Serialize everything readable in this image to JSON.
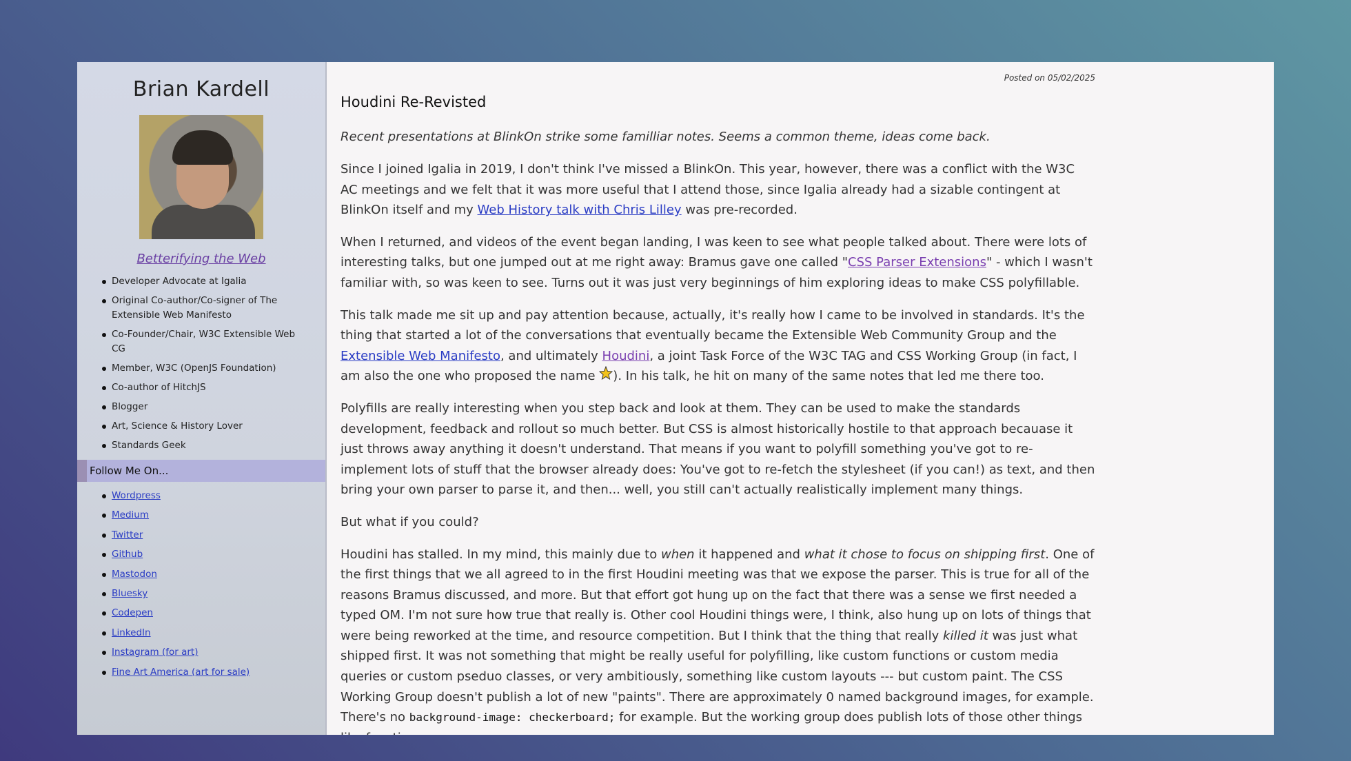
{
  "sidebar": {
    "author_name": "Brian Kardell",
    "blog_link": "Betterifying the Web",
    "bio": [
      "Developer Advocate at Igalia",
      "Original Co-author/Co-signer of The Extensible Web Manifesto",
      "Co-Founder/Chair, W3C Extensible Web CG",
      "Member, W3C (OpenJS Foundation)",
      "Co-author of HitchJS",
      "Blogger",
      "Art, Science & History Lover",
      "Standards Geek"
    ],
    "follow_header": "Follow Me On...",
    "follow_links": [
      "Wordpress",
      "Medium",
      "Twitter",
      "Github",
      "Mastodon",
      "Bluesky",
      "Codepen",
      "LinkedIn",
      "Instagram (for art)",
      "Fine Art America (art for sale)"
    ]
  },
  "article": {
    "posted": "Posted on 05/02/2025",
    "title": "Houdini Re-Revisted",
    "lede": "Recent presentations at BlinkOn strike some familliar notes. Seems a common theme, ideas come back.",
    "p1": {
      "a": "Since I joined Igalia in 2019, I don't think I've missed a BlinkOn. This year, however, there was a conflict with the W3C AC meetings and we felt that it was more useful that I attend those, since Igalia already had a sizable contingent at BlinkOn itself and my ",
      "link": "Web History talk with Chris Lilley",
      "b": " was pre-recorded."
    },
    "p2": {
      "a": "When I returned, and videos of the event began landing, I was keen to see what people talked about. There were lots of interesting talks, but one jumped out at me right away: Bramus gave one called \"",
      "link": "CSS Parser Extensions",
      "b": "\" - which I wasn't familiar with, so was keen to see. Turns out it was just very beginnings of him exploring ideas to make CSS polyfillable."
    },
    "p3": {
      "a": "This talk made me sit up and pay attention because, actually, it's really how I came to be involved in standards. It's the thing that started a lot of the conversations that eventually became the Extensible Web Community Group and the ",
      "link1": "Extensible Web Manifesto",
      "b": ", and ultimately ",
      "link2": "Houdini",
      "c": ", a joint Task Force of the W3C TAG and CSS Working Group (in fact, I am also the one who proposed the name ",
      "d": "). In his talk, he hit on many of the same notes that led me there too."
    },
    "p4": "Polyfills are really interesting when you step back and look at them. They can be used to make the standards development, feedback and rollout so much better. But CSS is almost historically hostile to that approach becauase it just throws away anything it doesn't understand. That means if you want to polyfill something you've got to re-implement lots of stuff that the browser already does: You've got to re-fetch the stylesheet (if you can!) as text, and then bring your own parser to parse it, and then... well, you still can't actually realistically implement many things.",
    "p5": "But what if you could?",
    "p6": {
      "a": "Houdini has stalled. In my mind, this mainly due to ",
      "em1": "when",
      "b": " it happened and ",
      "em2": "what it chose to focus on shipping first",
      "c": ". One of the first things that we all agreed to in the first Houdini meeting was that we expose the parser. This is true for all of the reasons Bramus discussed, and more. But that effort got hung up on the fact that there was a sense we first needed a typed OM. I'm not sure how true that really is. Other cool Houdini things were, I think, also hung up on lots of things that were being reworked at the time, and resource competition. But I think that the thing that really ",
      "em3": "killed it",
      "d": " was just what shipped first. It was not something that might be really useful for polyfilling, like custom functions or custom media queries or custom pseduo classes, or very ambitiously, something like custom layouts --- but custom paint. The CSS Working Group doesn't publish a lot of new \"paints\". There are approximately 0 named background images, for example. There's no ",
      "code": "background-image: checkerboard;",
      "e": " for example. But the working group does publish lots of those other things like functions or"
    }
  }
}
